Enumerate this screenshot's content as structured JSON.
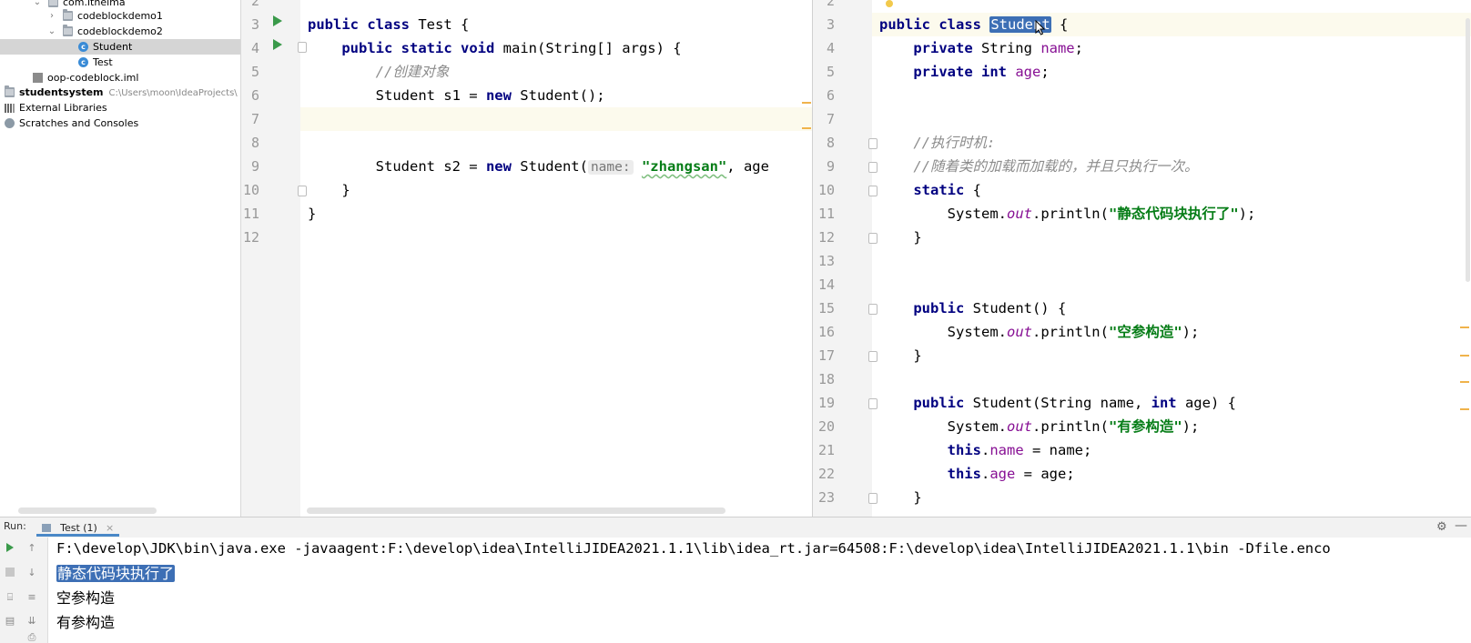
{
  "project_tree": {
    "items": [
      {
        "label": "com.itheima",
        "icon": "folder-icon",
        "arrow": "chevron-down-icon"
      },
      {
        "label": "codeblockdemo1",
        "icon": "folder-icon",
        "arrow": "chevron-right-icon"
      },
      {
        "label": "codeblockdemo2",
        "icon": "folder-icon",
        "arrow": "chevron-down-icon"
      },
      {
        "label": "Student",
        "icon": "class-icon",
        "selected": true
      },
      {
        "label": "Test",
        "icon": "class-icon"
      },
      {
        "label": "oop-codeblock.iml",
        "icon": "iml-file-icon"
      },
      {
        "label": "studentsystem",
        "path": "C:\\Users\\moon\\IdeaProjects\\",
        "icon": "folder-icon",
        "arrow": "chevron-right-icon"
      },
      {
        "label": "External Libraries",
        "icon": "library-icon",
        "arrow": "chevron-right-icon"
      },
      {
        "label": "Scratches and Consoles",
        "icon": "scratch-icon"
      }
    ]
  },
  "left_editor": {
    "line_numbers": [
      "2",
      "3",
      "4",
      "5",
      "6",
      "7",
      "8",
      "9",
      "10",
      "11",
      "12"
    ],
    "lines": [
      {
        "tokens": [
          {
            "t": "public ",
            "c": "kw"
          },
          {
            "t": "class ",
            "c": "kw"
          },
          {
            "t": "Test {",
            "c": ""
          }
        ]
      },
      {
        "tokens": [
          {
            "t": "    public ",
            "c": "kw"
          },
          {
            "t": "static ",
            "c": "kw"
          },
          {
            "t": "void ",
            "c": "kw"
          },
          {
            "t": "main(String[] args) {",
            "c": ""
          }
        ]
      },
      {
        "tokens": [
          {
            "t": "        //创建对象",
            "c": "cmt"
          }
        ]
      },
      {
        "tokens": [
          {
            "t": "        Student s1 = ",
            "c": ""
          },
          {
            "t": "new ",
            "c": "kw"
          },
          {
            "t": "Student();",
            "c": ""
          }
        ]
      },
      {
        "tokens": []
      },
      {
        "tokens": []
      },
      {
        "tokens": [
          {
            "t": "        Student s2 = ",
            "c": ""
          },
          {
            "t": "new ",
            "c": "kw"
          },
          {
            "t": "Student(",
            "c": ""
          },
          {
            "t": "name:",
            "c": "hint"
          },
          {
            "t": " ",
            "c": ""
          },
          {
            "t": "\"zhangsan\"",
            "c": "str"
          },
          {
            "t": ", age",
            "c": ""
          }
        ]
      },
      {
        "tokens": [
          {
            "t": "    }",
            "c": ""
          }
        ]
      },
      {
        "tokens": [
          {
            "t": "}",
            "c": ""
          }
        ]
      },
      {
        "tokens": []
      }
    ]
  },
  "right_editor": {
    "line_numbers": [
      "2",
      "3",
      "4",
      "5",
      "6",
      "7",
      "8",
      "9",
      "10",
      "11",
      "12",
      "13",
      "14",
      "15",
      "16",
      "17",
      "18",
      "19",
      "20",
      "21",
      "22",
      "23"
    ],
    "lines": [
      {
        "tokens": [
          {
            "t": "public ",
            "c": "kw"
          },
          {
            "t": "class ",
            "c": "kw"
          },
          {
            "t": "Student",
            "c": "sel"
          },
          {
            "t": " {",
            "c": ""
          }
        ]
      },
      {
        "tokens": [
          {
            "t": "    private ",
            "c": "kw"
          },
          {
            "t": "String ",
            "c": ""
          },
          {
            "t": "name",
            "c": "fld"
          },
          {
            "t": ";",
            "c": ""
          }
        ]
      },
      {
        "tokens": [
          {
            "t": "    private ",
            "c": "kw"
          },
          {
            "t": "int ",
            "c": "kw"
          },
          {
            "t": "age",
            "c": "fld"
          },
          {
            "t": ";",
            "c": ""
          }
        ]
      },
      {
        "tokens": []
      },
      {
        "tokens": []
      },
      {
        "tokens": [
          {
            "t": "    //执行时机:",
            "c": "cmt"
          }
        ]
      },
      {
        "tokens": [
          {
            "t": "    //随着类的加载而加载的，并且只执行一次。",
            "c": "cmt"
          }
        ]
      },
      {
        "tokens": [
          {
            "t": "    static ",
            "c": "kw"
          },
          {
            "t": "{",
            "c": ""
          }
        ]
      },
      {
        "tokens": [
          {
            "t": "        System.",
            "c": ""
          },
          {
            "t": "out",
            "c": "fld stat"
          },
          {
            "t": ".println(",
            "c": ""
          },
          {
            "t": "\"静态代码块执行了\"",
            "c": "str"
          },
          {
            "t": ");",
            "c": ""
          }
        ]
      },
      {
        "tokens": [
          {
            "t": "    }",
            "c": ""
          }
        ]
      },
      {
        "tokens": []
      },
      {
        "tokens": []
      },
      {
        "tokens": [
          {
            "t": "    public ",
            "c": "kw"
          },
          {
            "t": "Student() {",
            "c": ""
          }
        ]
      },
      {
        "tokens": [
          {
            "t": "        System.",
            "c": ""
          },
          {
            "t": "out",
            "c": "fld stat"
          },
          {
            "t": ".println(",
            "c": ""
          },
          {
            "t": "\"空参构造\"",
            "c": "str"
          },
          {
            "t": ");",
            "c": ""
          }
        ]
      },
      {
        "tokens": [
          {
            "t": "    }",
            "c": ""
          }
        ]
      },
      {
        "tokens": []
      },
      {
        "tokens": [
          {
            "t": "    public ",
            "c": "kw"
          },
          {
            "t": "Student(String name, ",
            "c": ""
          },
          {
            "t": "int ",
            "c": "kw"
          },
          {
            "t": "age) {",
            "c": ""
          }
        ]
      },
      {
        "tokens": [
          {
            "t": "        System.",
            "c": ""
          },
          {
            "t": "out",
            "c": "fld stat"
          },
          {
            "t": ".println(",
            "c": ""
          },
          {
            "t": "\"有参构造\"",
            "c": "str"
          },
          {
            "t": ");",
            "c": ""
          }
        ]
      },
      {
        "tokens": [
          {
            "t": "        this",
            "c": "kw"
          },
          {
            "t": ".",
            "c": ""
          },
          {
            "t": "name",
            "c": "fld"
          },
          {
            "t": " = name;",
            "c": ""
          }
        ]
      },
      {
        "tokens": [
          {
            "t": "        this",
            "c": "kw"
          },
          {
            "t": ".",
            "c": ""
          },
          {
            "t": "age",
            "c": "fld"
          },
          {
            "t": " = age;",
            "c": ""
          }
        ]
      },
      {
        "tokens": [
          {
            "t": "    }",
            "c": ""
          }
        ]
      }
    ]
  },
  "run_panel": {
    "label": "Run:",
    "tab_label": "Test (1)",
    "close_glyph": "×",
    "console_lines": [
      "F:\\develop\\JDK\\bin\\java.exe -javaagent:F:\\develop\\idea\\IntelliJIDEA2021.1.1\\lib\\idea_rt.jar=64508:F:\\develop\\idea\\IntelliJIDEA2021.1.1\\bin -Dfile.enco",
      "静态代码块执行了",
      "空参构造",
      "有参构造"
    ]
  },
  "colors": {
    "keyword": "#000080",
    "string": "#067d17",
    "comment": "#8c8c8c",
    "field": "#871094",
    "selection": "#3d6fb5",
    "run_icon": "#3a9a4a"
  }
}
